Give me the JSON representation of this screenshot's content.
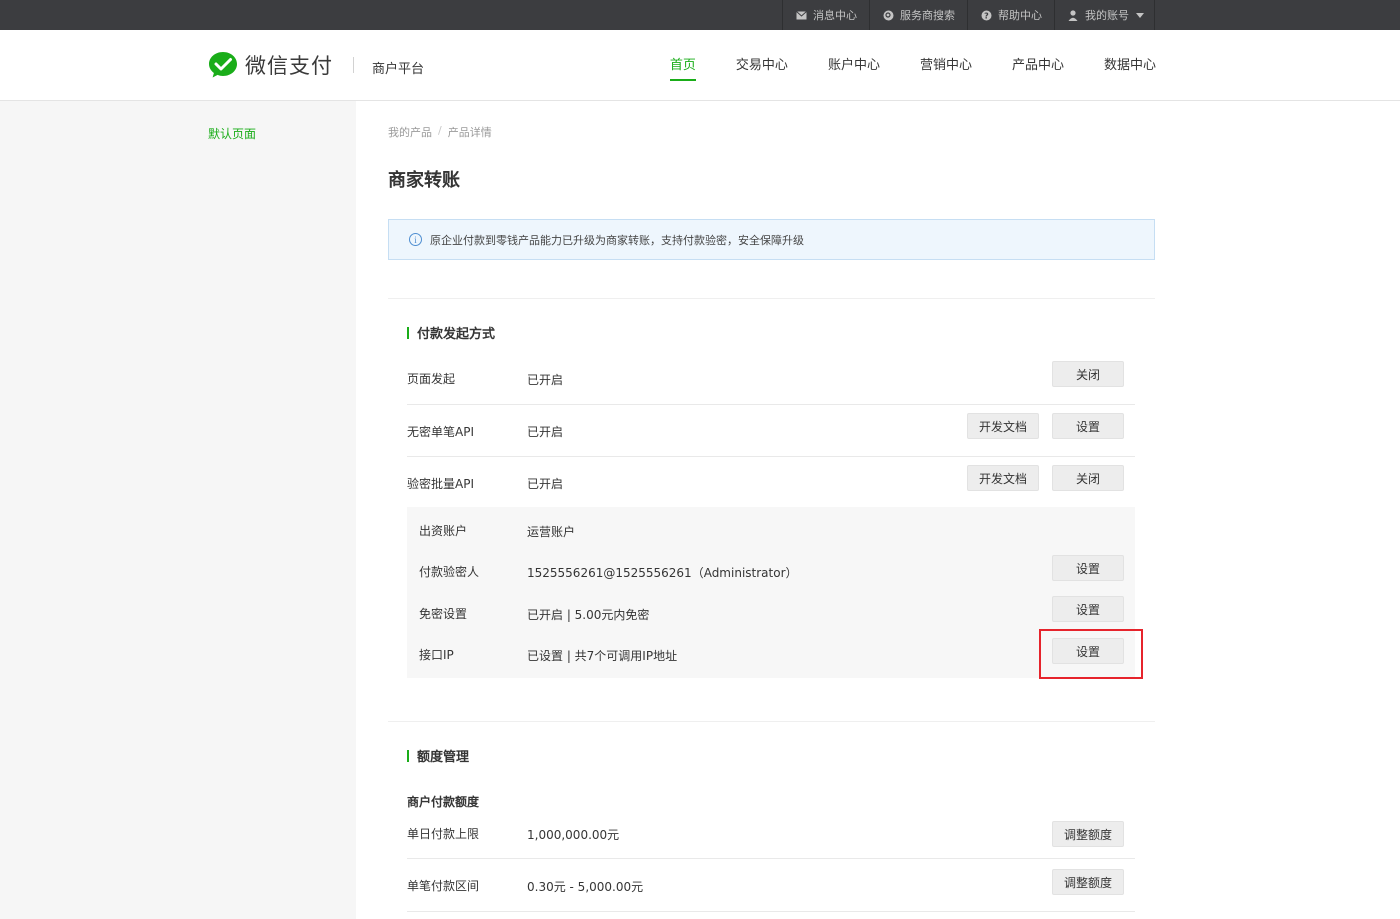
{
  "topbar": {
    "links": [
      {
        "label": "消息中心",
        "icon": "mail-icon"
      },
      {
        "label": "服务商搜索",
        "icon": "search-circle-icon"
      },
      {
        "label": "帮助中心",
        "icon": "help-icon"
      },
      {
        "label": "我的账号",
        "icon": "user-icon"
      }
    ]
  },
  "header": {
    "brand": "微信支付",
    "platform": "商户平台",
    "nav": [
      "首页",
      "交易中心",
      "账户中心",
      "营销中心",
      "产品中心",
      "数据中心"
    ],
    "active_nav": "首页"
  },
  "sidebar": {
    "item": "默认页面"
  },
  "breadcrumb": {
    "items": [
      "我的产品",
      "产品详情"
    ],
    "separator": "/"
  },
  "page_title": "商家转账",
  "notice": "原企业付款到零钱产品能力已升级为商家转账，支持付款验密，安全保障升级",
  "payment": {
    "title": "付款发起方式",
    "rows": [
      {
        "key": "页面发起",
        "value": "已开启",
        "buttons": [
          "关闭"
        ]
      },
      {
        "key": "无密单笔API",
        "value": "已开启",
        "buttons": [
          "开发文档",
          "设置"
        ]
      },
      {
        "key": "验密批量API",
        "value": "已开启",
        "buttons": [
          "开发文档",
          "关闭"
        ]
      }
    ],
    "sub_rows": [
      {
        "key": "出资账户",
        "value": "运营账户",
        "button": ""
      },
      {
        "key": "付款验密人",
        "value": "1525556261@1525556261（Administrator）",
        "button": "设置"
      },
      {
        "key": "免密设置",
        "value": "已开启 | 5.00元内免密",
        "button": "设置"
      },
      {
        "key": "接口IP",
        "value": "已设置 | 共7个可调用IP地址",
        "button": "设置"
      }
    ]
  },
  "quota": {
    "title": "额度管理",
    "subhead": "商户付款额度",
    "rows": [
      {
        "key": "单日付款上限",
        "value": "1,000,000.00元",
        "button": "调整额度"
      },
      {
        "key": "单笔付款区间",
        "value": "0.30元 - 5,000.00元",
        "button": "调整额度"
      }
    ]
  },
  "colors": {
    "accent": "#1aad19",
    "highlight": "#e6242c",
    "topbar": "#3c3d40"
  }
}
